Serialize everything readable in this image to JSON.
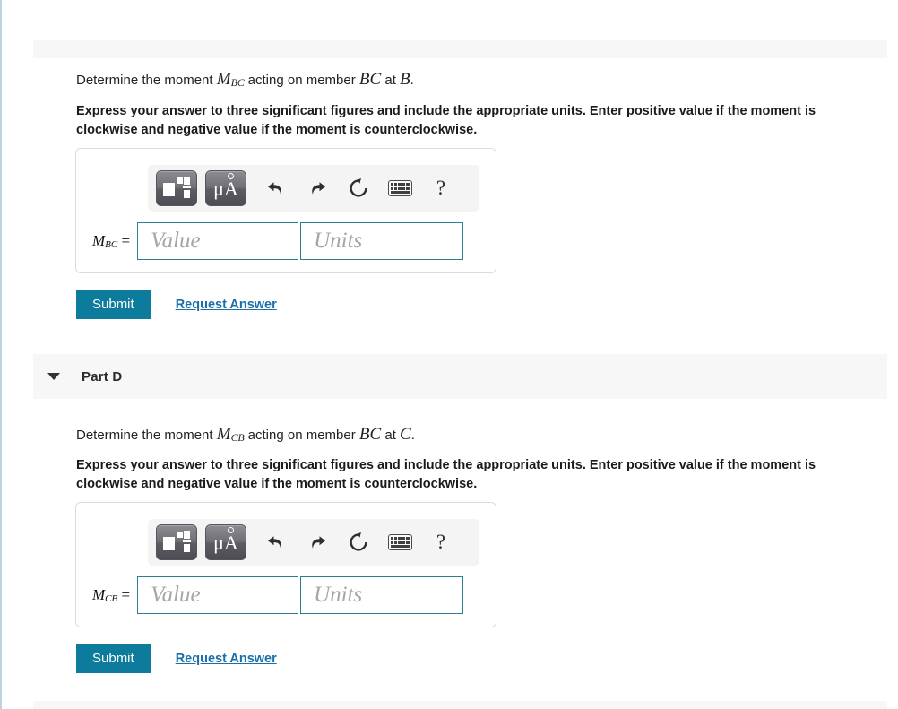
{
  "page": {
    "top_band": "",
    "bottom_band": ""
  },
  "parts": [
    {
      "id": "part-c-continued",
      "header_visible": false,
      "header_label": "",
      "caret_icon": "caret-down-icon",
      "question": {
        "prefix": "Determine the moment ",
        "symbol": "M",
        "subscript": "BC",
        "middle": " acting on member ",
        "member": "BC",
        "at": " at ",
        "point": "B",
        "period": "."
      },
      "instruction": "Express your answer to three significant figures and include the appropriate units. Enter positive value if the moment is clockwise and negative value if the moment is counterclockwise.",
      "toolbar": {
        "template_button": "math-template-button",
        "units_button_label": "μA",
        "undo_label": "undo",
        "redo_label": "redo",
        "reset_label": "reset",
        "keyboard_label": "keyboard",
        "help_label": "?"
      },
      "answer": {
        "label_symbol": "M",
        "label_subscript": "BC",
        "label_equals": "=",
        "value_placeholder": "Value",
        "units_placeholder": "Units",
        "value": "",
        "units": ""
      },
      "actions": {
        "submit_label": "Submit",
        "request_answer_label": "Request Answer"
      }
    },
    {
      "id": "part-d",
      "header_visible": true,
      "header_label": "Part D",
      "caret_icon": "caret-down-icon",
      "question": {
        "prefix": "Determine the moment ",
        "symbol": "M",
        "subscript": "CB",
        "middle": " acting on member ",
        "member": "BC",
        "at": " at ",
        "point": "C",
        "period": "."
      },
      "instruction": "Express your answer to three significant figures and include the appropriate units. Enter positive value if the moment is clockwise and negative value if the moment is counterclockwise.",
      "toolbar": {
        "template_button": "math-template-button",
        "units_button_label": "μA",
        "undo_label": "undo",
        "redo_label": "redo",
        "reset_label": "reset",
        "keyboard_label": "keyboard",
        "help_label": "?"
      },
      "answer": {
        "label_symbol": "M",
        "label_subscript": "CB",
        "label_equals": "=",
        "value_placeholder": "Value",
        "units_placeholder": "Units",
        "value": "",
        "units": ""
      },
      "actions": {
        "submit_label": "Submit",
        "request_answer_label": "Request Answer"
      }
    }
  ],
  "colors": {
    "submit_bg": "#0d7b9b",
    "link": "#1a6fa8",
    "field_border": "#2c7e93",
    "band_bg": "#f7f7f8",
    "left_edge": "#bcd2e0"
  }
}
